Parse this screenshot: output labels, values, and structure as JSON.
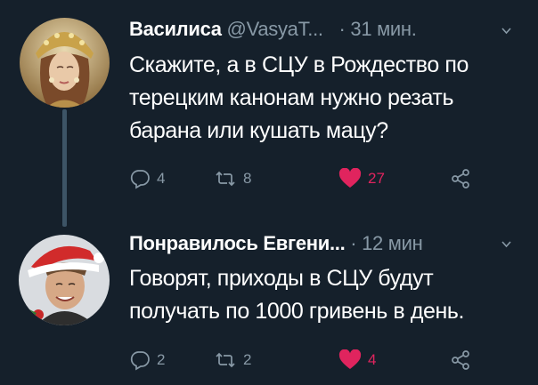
{
  "tweets": [
    {
      "name": "Василиса",
      "handle": "@VasyaT...",
      "separator": "·",
      "time": "31 мин.",
      "text": "Скажите, а в СЦУ в Рождество по терецким канонам нужно резать барана или кушать мацу?",
      "replies": "4",
      "retweets": "8",
      "likes": "27",
      "liked": true
    },
    {
      "name": "Понравилось Евгени...",
      "separator": "·",
      "time": "12 мин",
      "text": "Говорят, приходы в СЦУ будут получать по 1000 гривень в день.",
      "replies": "2",
      "retweets": "2",
      "likes": "4",
      "liked": true
    }
  ],
  "colors": {
    "background": "#15202b",
    "text": "#ffffff",
    "muted": "#8899a6",
    "like": "#e0245e",
    "thread_line": "#3d5466"
  },
  "icons": [
    "reply-icon",
    "retweet-icon",
    "like-icon",
    "share-icon",
    "chevron-down-icon"
  ]
}
